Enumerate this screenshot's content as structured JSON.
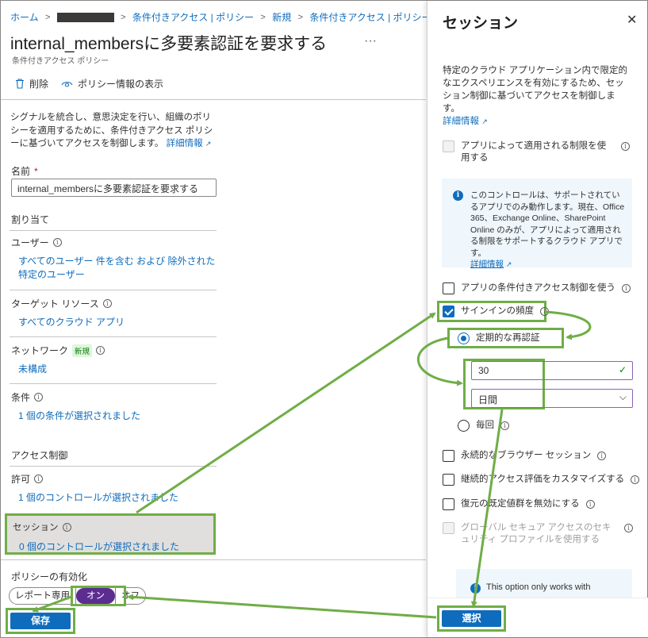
{
  "breadcrumb": {
    "items": [
      "ホーム",
      "条件付きアクセス | ポリシー",
      "新規",
      "条件付きアクセス | ポリシー"
    ]
  },
  "page": {
    "title": "internal_membersに多要素認証を要求する",
    "more": "···",
    "subtitle": "条件付きアクセス ポリシー"
  },
  "toolbar": {
    "delete_label": "削除",
    "view_policy_label": "ポリシー情報の表示"
  },
  "intro": {
    "text": "シグナルを統合し、意思決定を行い、組織のポリシーを適用するために、条件付きアクセス ポリシーに基づいてアクセスを制御します。",
    "link": "詳細情報"
  },
  "name_field": {
    "label": "名前",
    "required": "*",
    "value": "internal_membersに多要素認証を要求する"
  },
  "assignments": {
    "heading": "割り当て",
    "users_label": "ユーザー",
    "users_value": "すべてのユーザー 件を含む および 除外された特定のユーザー",
    "target_label": "ターゲット リソース",
    "target_value": "すべてのクラウド アプリ",
    "network_label": "ネットワーク",
    "network_badge": "新規",
    "network_value": "未構成",
    "conditions_label": "条件",
    "conditions_value": "1 個の条件が選択されました"
  },
  "access_controls": {
    "heading": "アクセス制御",
    "grant_label": "許可",
    "grant_value": "1 個のコントロールが選択されました",
    "session_label": "セッション",
    "session_value": "0 個のコントロールが選択されました"
  },
  "enable_policy": {
    "label": "ポリシーの有効化",
    "options": [
      "レポート専用",
      "オン",
      "オフ"
    ],
    "selected": "オン"
  },
  "save_label": "保存",
  "panel": {
    "title": "セッション",
    "close": "✕",
    "description": "特定のクラウド アプリケーション内で限定的なエクスペリエンスを有効にするため、セッション制御に基づいてアクセスを制御します。",
    "learn_more": "詳細情報",
    "app_enforced": "アプリによって適用される制限を使用する",
    "notice_text": "このコントロールは、サポートされているアプリでのみ動作します。現在、Office 365、Exchange Online、SharePoint Online のみが、アプリによって適用される制限をサポートするクラウド アプリです。",
    "notice_link": "詳細情報",
    "conditional_access_app": "アプリの条件付きアクセス制御を使う",
    "signin_frequency": "サインインの頻度",
    "periodic_reauth": "定期的な再認証",
    "frequency_value": "30",
    "frequency_unit": "日間",
    "every_time": "毎回",
    "persistent_browser": "永続的なブラウザー セッション",
    "cae": "継続的アクセス評価をカスタマイズする",
    "disable_resilience": "復元の既定値群を無効にする",
    "global_secure": "グローバル セキュア アクセスのセキュリティ プロファイルを使用する",
    "option_notice": "This option only works with",
    "select_label": "選択"
  },
  "colors": {
    "accent": "#0f6cbd",
    "highlight": "#70ad47",
    "toggle_on": "#5c2d91"
  }
}
